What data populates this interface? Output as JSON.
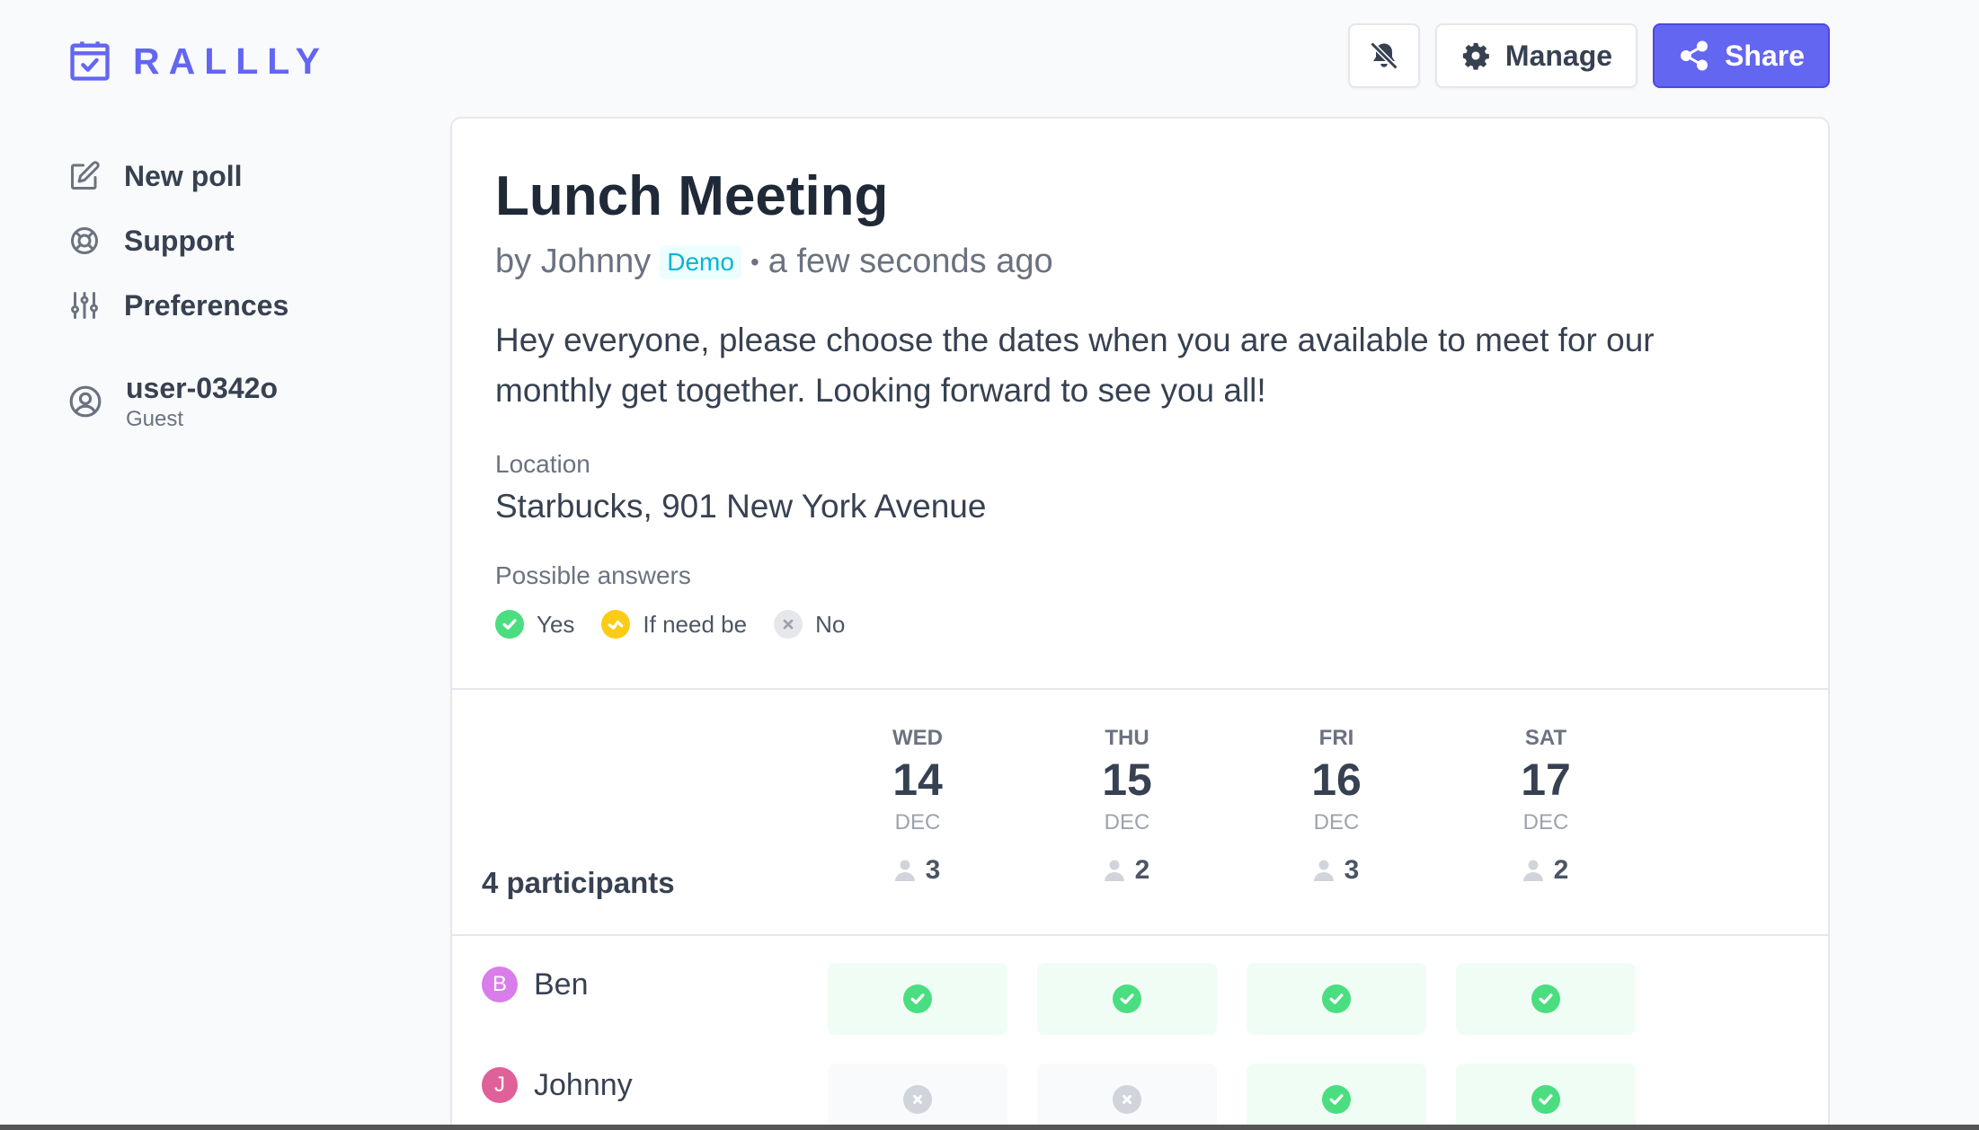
{
  "app": {
    "logo_text": "RALLLY",
    "brand_color": "#6366f1"
  },
  "sidebar": {
    "items": [
      {
        "label": "New poll",
        "icon": "pencil-square-icon"
      },
      {
        "label": "Support",
        "icon": "lifebuoy-icon"
      },
      {
        "label": "Preferences",
        "icon": "adjustments-icon"
      }
    ],
    "user": {
      "name": "user-0342o",
      "role": "Guest"
    }
  },
  "toolbar": {
    "notifications_icon": "bell-off-icon",
    "manage_label": "Manage",
    "share_label": "Share"
  },
  "poll": {
    "title": "Lunch Meeting",
    "by": "by Johnny",
    "badge": "Demo",
    "separator": "•",
    "time": "a few seconds ago",
    "description": "Hey everyone, please choose the dates when you are available to meet for our monthly get together. Looking forward to see you all!",
    "location_label": "Location",
    "location": "Starbucks, 901 New York Avenue",
    "answers_label": "Possible answers",
    "answers": [
      {
        "label": "Yes",
        "color": "#4ade80"
      },
      {
        "label": "If need be",
        "color": "#facc15"
      },
      {
        "label": "No",
        "color": "#e5e7eb"
      }
    ]
  },
  "grid": {
    "participants_label": "4 participants",
    "columns": [
      {
        "dow": "WED",
        "day": "14",
        "month": "DEC",
        "count": "3"
      },
      {
        "dow": "THU",
        "day": "15",
        "month": "DEC",
        "count": "2"
      },
      {
        "dow": "FRI",
        "day": "16",
        "month": "DEC",
        "count": "3"
      },
      {
        "dow": "SAT",
        "day": "17",
        "month": "DEC",
        "count": "2"
      }
    ],
    "rows": [
      {
        "initial": "B",
        "name": "Ben",
        "avatar_color": "#d97dea",
        "votes": [
          "yes",
          "yes",
          "yes",
          "yes"
        ]
      },
      {
        "initial": "J",
        "name": "Johnny",
        "avatar_color": "#e0609a",
        "votes": [
          "no",
          "no",
          "yes",
          "yes"
        ]
      }
    ]
  }
}
